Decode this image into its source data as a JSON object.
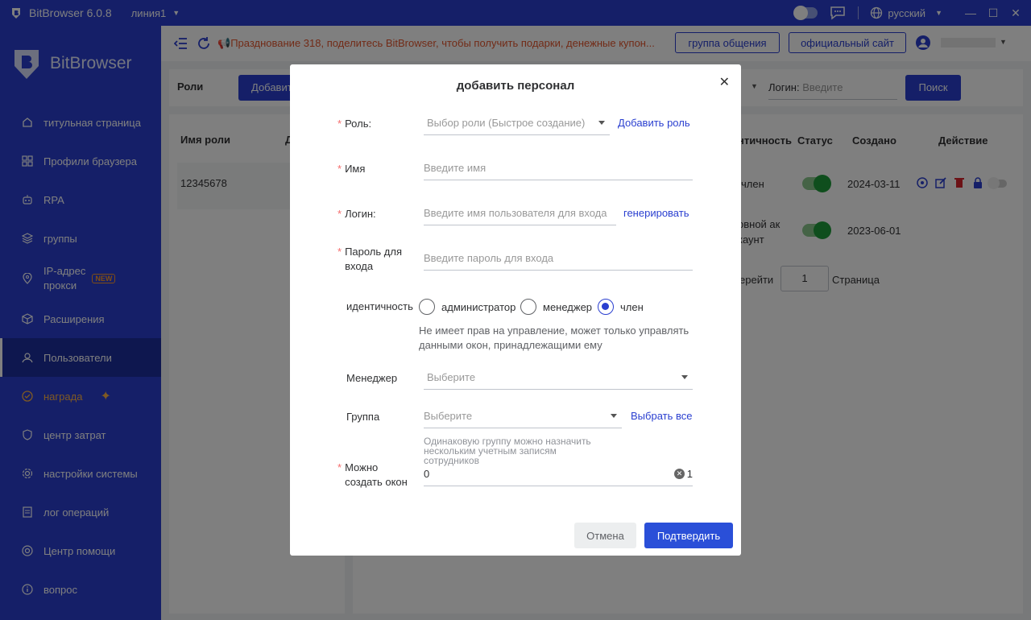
{
  "titlebar": {
    "app_name": "BitBrowser 6.0.8",
    "line": "линия1",
    "language": "русский"
  },
  "sidebar": {
    "brand": "BitBrowser",
    "new_badge": "NEW",
    "items": [
      {
        "label": "титульная страница",
        "icon": "home-icon"
      },
      {
        "label": "Профили браузера",
        "icon": "grid-icon"
      },
      {
        "label": "RPA",
        "icon": "robot-icon"
      },
      {
        "label": "группы",
        "icon": "layers-icon"
      },
      {
        "label": "IP-адрес\nпрокси",
        "icon": "location-icon"
      },
      {
        "label": "Расширения",
        "icon": "cube-icon"
      },
      {
        "label": "Пользователи",
        "icon": "user-icon"
      },
      {
        "label": "награда",
        "icon": "reward-icon"
      },
      {
        "label": "центр затрат",
        "icon": "shield-icon"
      },
      {
        "label": "настройки системы",
        "icon": "gear-icon"
      },
      {
        "label": "лог операций",
        "icon": "log-icon"
      },
      {
        "label": "Центр помощи",
        "icon": "help-icon"
      },
      {
        "label": "вопрос",
        "icon": "info-icon"
      }
    ]
  },
  "topbar": {
    "promo": "Празднование 318, поделитесь BitBrowser, чтобы получить подарки, денежные купон...",
    "group_btn": "группа общения",
    "site_btn": "официальный сайт"
  },
  "filter": {
    "roles_label": "Роли",
    "add_btn": "Добавит",
    "login_label": "Логин:",
    "login_placeholder": "Введите",
    "search_btn": "Поиск"
  },
  "roles_table": {
    "header": "Имя роли",
    "header2": "Д",
    "row": "12345678"
  },
  "users_table": {
    "headers": [
      "нтичность",
      "Статус",
      "Создано",
      "Действие"
    ],
    "rows": [
      {
        "identity": "член",
        "created": "2024-03-11"
      },
      {
        "identity": "овной ак\nкаунт",
        "created": "2023-06-01"
      }
    ],
    "pager_goto": "ерейти",
    "pager_value": "1",
    "pager_page": "Страница"
  },
  "modal": {
    "title": "добавить персонал",
    "role_label": "Роль:",
    "role_placeholder": "Выбор роли (Быстрое создание)",
    "add_role": "Добавить роль",
    "name_label": "Имя",
    "name_placeholder": "Введите имя",
    "login_label": "Логин:",
    "login_placeholder": "Введите имя пользователя для входа",
    "generate": "генерировать",
    "password_label": "Пароль для\nвхода",
    "password_placeholder": "Введите пароль для входа",
    "identity_label": "идентичность",
    "identity_options": [
      "администратор",
      "менеджер",
      "член"
    ],
    "identity_selected": "член",
    "identity_hint": "Не имеет прав на управление, может только управлять\nданными окон, принадлежащими ему",
    "manager_label": "Менеджер",
    "manager_placeholder": "Выберите",
    "group_label": "Группа",
    "group_placeholder": "Выберите",
    "select_all": "Выбрать все",
    "group_hint": "Одинаковую группу можно назначить\nнескольким учетным записям\nсотрудников",
    "windows_label": "Можно\nсоздать окон",
    "windows_value": "0",
    "windows_suffix": "1",
    "cancel": "Отмена",
    "confirm": "Подтвердить"
  },
  "colors": {
    "primary": "#2a3fd0",
    "accent_orange": "#e4572e",
    "success": "#1f9d3a",
    "danger": "#d9252c"
  }
}
